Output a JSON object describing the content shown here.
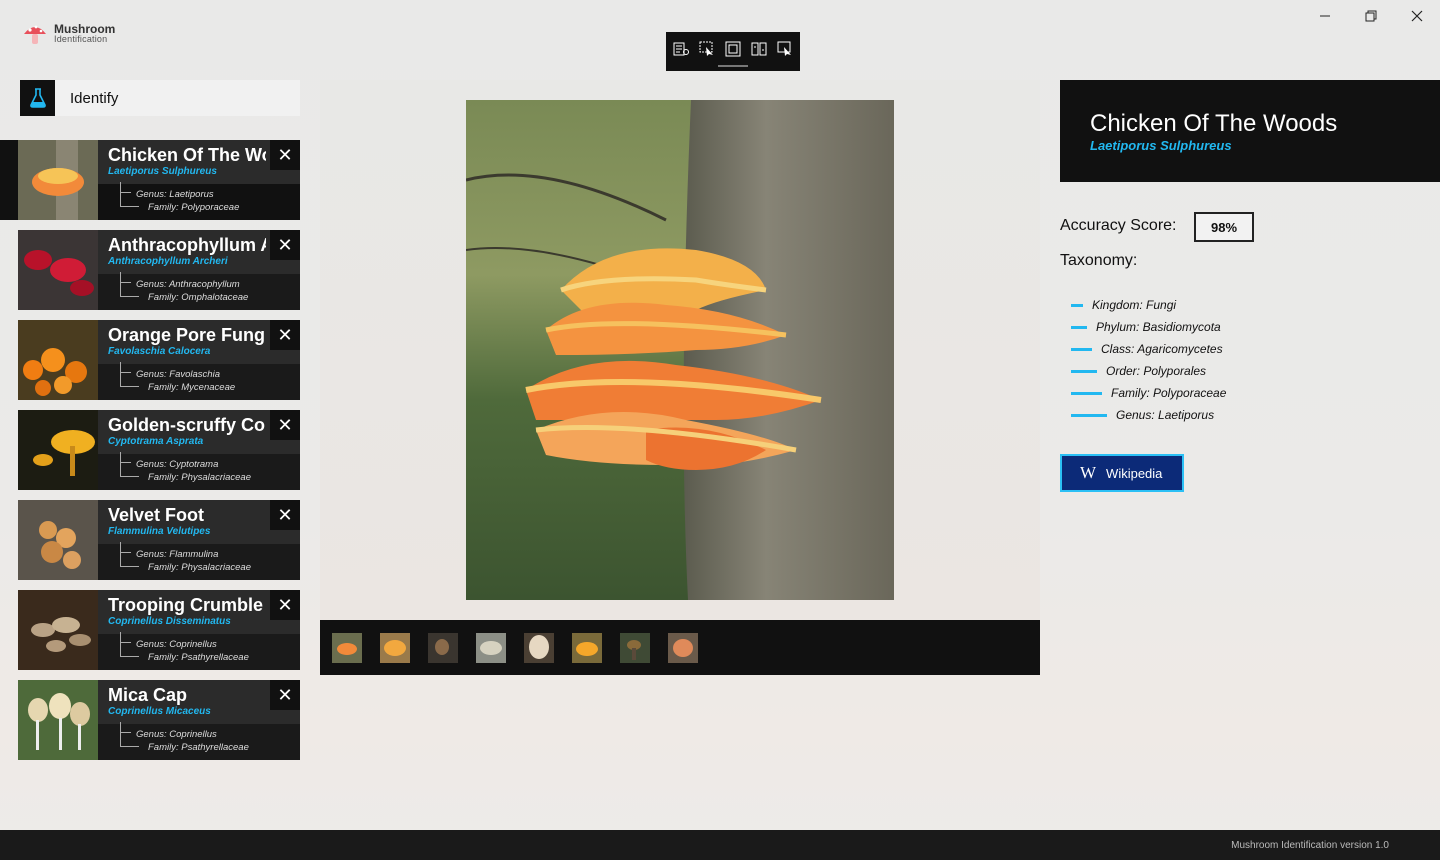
{
  "app": {
    "title_line1": "Mushroom",
    "title_line2": "Identification",
    "version_text": "Mushroom Identification version 1.0"
  },
  "window_controls": [
    "minimize",
    "maximize",
    "close"
  ],
  "identify_button": {
    "label": "Identify",
    "icon": "flask-icon"
  },
  "history": [
    {
      "name": "Chicken Of The Woods",
      "scientific": "Laetiporus Sulphureus",
      "genus_label": "Genus:",
      "genus": "Laetiporus",
      "family_label": "Family:",
      "family": "Polyporaceae",
      "selected": true
    },
    {
      "name": "Anthracophyllum Archeri",
      "scientific": "Anthracophyllum Archeri",
      "genus_label": "Genus:",
      "genus": "Anthracophyllum",
      "family_label": "Family:",
      "family": "Omphalotaceae"
    },
    {
      "name": "Orange Pore Fungus",
      "scientific": "Favolaschia Calocera",
      "genus_label": "Genus:",
      "genus": "Favolaschia",
      "family_label": "Family:",
      "family": "Mycenaceae"
    },
    {
      "name": "Golden-scruffy Collybia",
      "scientific": "Cyptotrama Asprata",
      "genus_label": "Genus:",
      "genus": "Cyptotrama",
      "family_label": "Family:",
      "family": "Physalacriaceae"
    },
    {
      "name": "Velvet Foot",
      "scientific": "Flammulina Velutipes",
      "genus_label": "Genus:",
      "genus": "Flammulina",
      "family_label": "Family:",
      "family": "Physalacriaceae"
    },
    {
      "name": "Trooping Crumble Cap",
      "scientific": "Coprinellus Disseminatus",
      "genus_label": "Genus:",
      "genus": "Coprinellus",
      "family_label": "Family:",
      "family": "Psathyrellaceae"
    },
    {
      "name": "Mica Cap",
      "scientific": "Coprinellus Micaceus",
      "genus_label": "Genus:",
      "genus": "Coprinellus",
      "family_label": "Family:",
      "family": "Psathyrellaceae"
    }
  ],
  "detail": {
    "name": "Chicken Of The Woods",
    "scientific": "Laetiporus Sulphureus",
    "accuracy_label": "Accuracy Score:",
    "accuracy_value": "98%",
    "taxonomy_label": "Taxonomy:",
    "taxonomy": [
      "Kingdom: Fungi",
      "Phylum: Basidiomycota",
      "Class: Agaricomycetes",
      "Order: Polyporales",
      "Family: Polyporaceae",
      "Genus: Laetiporus"
    ],
    "wikipedia_label": "Wikipedia"
  },
  "filmstrip_count": 8,
  "colors": {
    "accent": "#22b8f0",
    "panel_dark": "#111111",
    "wiki_bg": "#0c2a78"
  }
}
